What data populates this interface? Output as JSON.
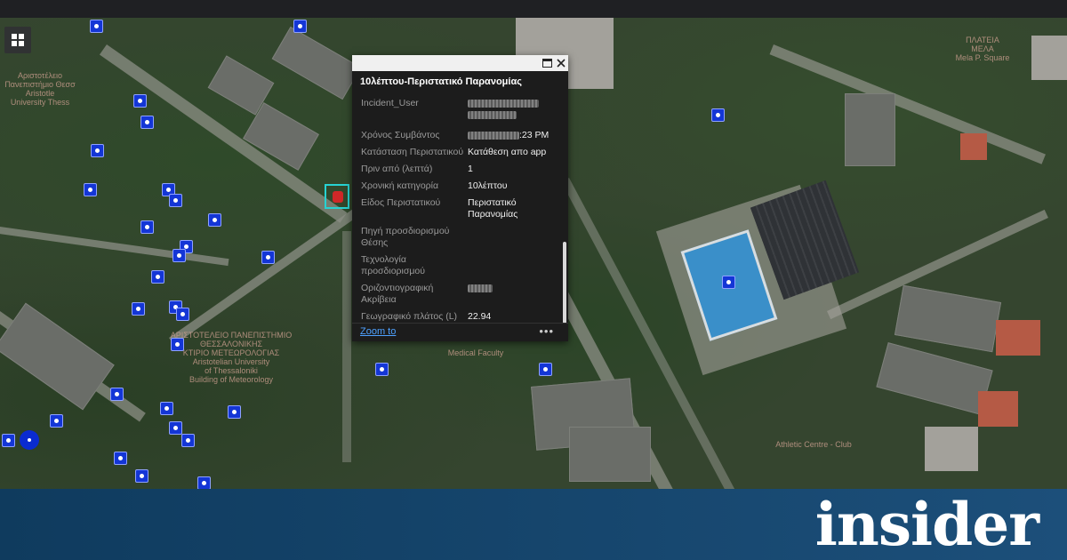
{
  "map": {
    "labels": [
      {
        "text": "Αριστοτέλειο\nΠανεπιστήμιο Θεσσ\nAristotle\nUniversity Thess"
      },
      {
        "text": "ΑΡΙΣΤΟΤΕΛΕΙΟ ΠΑΝΕΠΙΣΤΗΜΙΟ\nΘΕΣΣΑΛΟΝΙΚΗΣ\nΚΤΙΡΙΟ ΜΕΤΕΩΡΟΛΟΓΙΑΣ\nAristotelian University\nof Thessaloniki\nBuilding of Meteorology"
      },
      {
        "text": "Medical Faculty"
      },
      {
        "text": "ΠΛΑΤΕΙΑ\nΜΕΛΑ\nMela P. Square"
      },
      {
        "text": "Athletic Centre - Club"
      }
    ]
  },
  "popup": {
    "title": "10λέπτου-Περιστατικό Παρανομίας",
    "fields": [
      {
        "key": "Incident_User",
        "value": "",
        "redacted": true
      },
      {
        "key": "Χρόνος Συμβάντος",
        "value": ":23 PM",
        "redacted_prefix": true
      },
      {
        "key": "Κατάσταση Περιστατικού",
        "value": "Κατάθεση απο app"
      },
      {
        "key": "Πριν από (λεπτά)",
        "value": "1"
      },
      {
        "key": "Χρονική κατηγορία",
        "value": "10λέπτου"
      },
      {
        "key": "Είδος Περιστατικού",
        "value": "Περιστατικό Παρανομίας"
      },
      {
        "key": "Πηγή προσδιορισμού Θέσης",
        "value": ""
      },
      {
        "key": "Τεχνολογία προσδιορισμού",
        "value": ""
      },
      {
        "key": "Οριζοντιογραφική Ακρίβεια",
        "value": "",
        "redacted": true
      },
      {
        "key": "Γεωγραφικό πλάτος (L)",
        "value": "22.94"
      }
    ],
    "zoom_label": "Zoom to",
    "more_label": "•••"
  },
  "banner": {
    "brand": "insider"
  },
  "colors": {
    "marker": "#1436d6",
    "selected_outline": "#27d2d2",
    "banner": "#1c4f7a",
    "link": "#4ea1ff"
  }
}
